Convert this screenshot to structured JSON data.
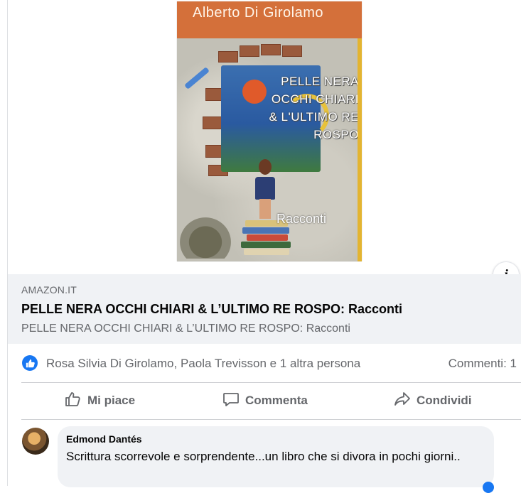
{
  "book_cover": {
    "author": "Alberto Di Girolamo",
    "title": "PELLE NERA OCCHI CHIARI & L'ULTIMO RE ROSPO",
    "subtitle": "Racconti"
  },
  "link_preview": {
    "domain": "AMAZON.IT",
    "title": "PELLE NERA OCCHI CHIARI & L’ULTIMO RE ROSPO: Racconti",
    "description": "PELLE NERA OCCHI CHIARI & L’ULTIMO RE ROSPO: Racconti",
    "info_icon": "i"
  },
  "reactions": {
    "icon": "thumbs-up",
    "names": "Rosa Silvia Di Girolamo, Paola Trevisson e 1 altra persona",
    "comments": "Commenti: 1"
  },
  "actions": {
    "like": "Mi piace",
    "comment": "Commenta",
    "share": "Condividi"
  },
  "comment": {
    "author": "Edmond Dantés",
    "text": "Scrittura scorrevole e sorprendente...un libro che si divora in pochi giorni.."
  },
  "colors": {
    "accent": "#1877f2",
    "muted_text": "#65676b",
    "preview_bg": "#f0f2f5",
    "cover_banner": "#d4703a"
  }
}
